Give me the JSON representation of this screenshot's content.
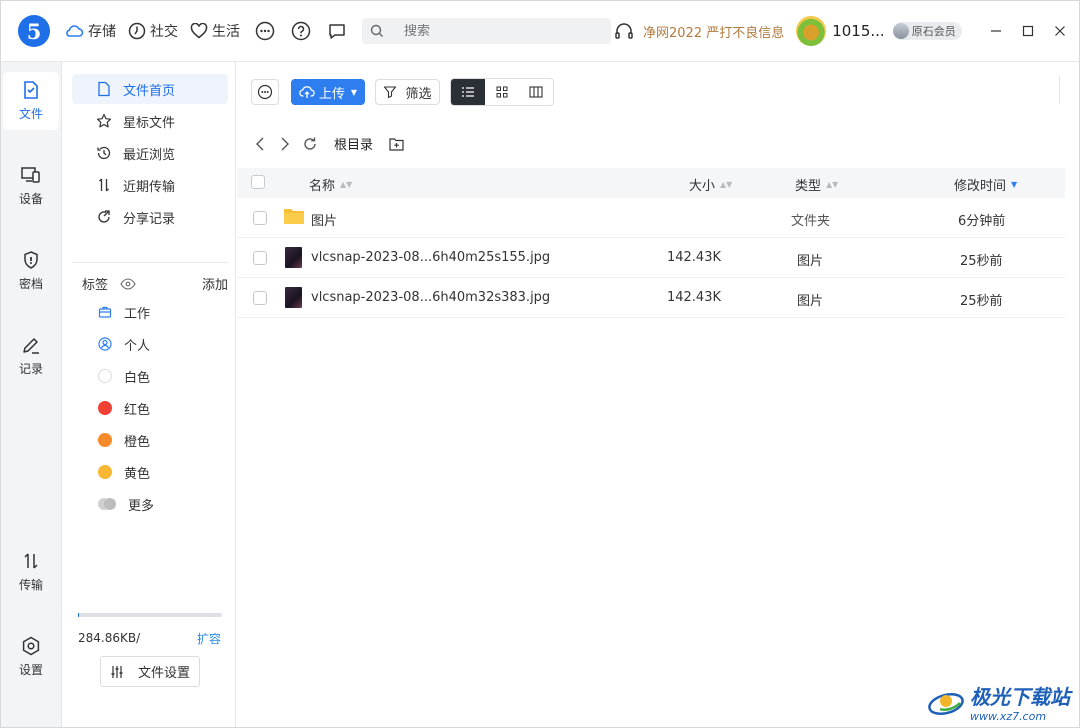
{
  "titlebar": {
    "logo": "5",
    "nav": [
      {
        "label": "存储",
        "icon": "cloud-icon"
      },
      {
        "label": "社交",
        "icon": "clock-icon"
      },
      {
        "label": "生活",
        "icon": "heart-icon"
      }
    ],
    "search_placeholder": "搜索",
    "notice": "净网2022 严打不良信息",
    "user_id": "1015...",
    "vip_label": "原石会员",
    "window_controls": [
      "minimize",
      "maximize",
      "close"
    ]
  },
  "rail": {
    "items": [
      {
        "label": "文件",
        "icon": "file-icon",
        "active": true
      },
      {
        "label": "设备",
        "icon": "device-icon"
      },
      {
        "label": "密档",
        "icon": "shield-icon"
      },
      {
        "label": "记录",
        "icon": "edit-icon"
      },
      {
        "label": "传输",
        "icon": "transfer-icon"
      },
      {
        "label": "设置",
        "icon": "settings-icon"
      }
    ]
  },
  "sidebar": {
    "items": [
      {
        "label": "文件首页",
        "icon": "file-icon",
        "active": true
      },
      {
        "label": "星标文件",
        "icon": "star-icon"
      },
      {
        "label": "最近浏览",
        "icon": "history-icon"
      },
      {
        "label": "近期传输",
        "icon": "transfer-icon"
      },
      {
        "label": "分享记录",
        "icon": "share-icon"
      }
    ],
    "tags_title": "标签",
    "tags_add": "添加",
    "tags": [
      {
        "label": "工作",
        "icon": "briefcase-icon",
        "color": "#2f7ef0"
      },
      {
        "label": "个人",
        "icon": "person-icon",
        "color": "#2f7ef0"
      },
      {
        "label": "白色",
        "color": "#ffffff"
      },
      {
        "label": "红色",
        "color": "#f04134"
      },
      {
        "label": "橙色",
        "color": "#f58a2b"
      },
      {
        "label": "黄色",
        "color": "#f9b733"
      },
      {
        "label": "更多",
        "color": "#c8c8c8"
      }
    ],
    "storage_used": "284.86KB/",
    "storage_fill": 0.001,
    "expand_label": "扩容",
    "file_settings_label": "文件设置"
  },
  "toolbar": {
    "upload_label": "上传",
    "filter_label": "筛选"
  },
  "breadcrumb": {
    "root": "根目录"
  },
  "table": {
    "columns": {
      "name": "名称",
      "size": "大小",
      "type": "类型",
      "modified": "修改时间"
    },
    "rows": [
      {
        "name": "图片",
        "size": "",
        "type": "文件夹",
        "modified": "6分钟前",
        "kind": "folder"
      },
      {
        "name": "vlcsnap-2023-08...6h40m25s155.jpg",
        "size": "142.43K",
        "type": "图片",
        "modified": "25秒前",
        "kind": "image"
      },
      {
        "name": "vlcsnap-2023-08...6h40m32s383.jpg",
        "size": "142.43K",
        "type": "图片",
        "modified": "25秒前",
        "kind": "image"
      }
    ]
  },
  "watermark": {
    "text": "极光下载站",
    "url": "www.xz7.com"
  }
}
